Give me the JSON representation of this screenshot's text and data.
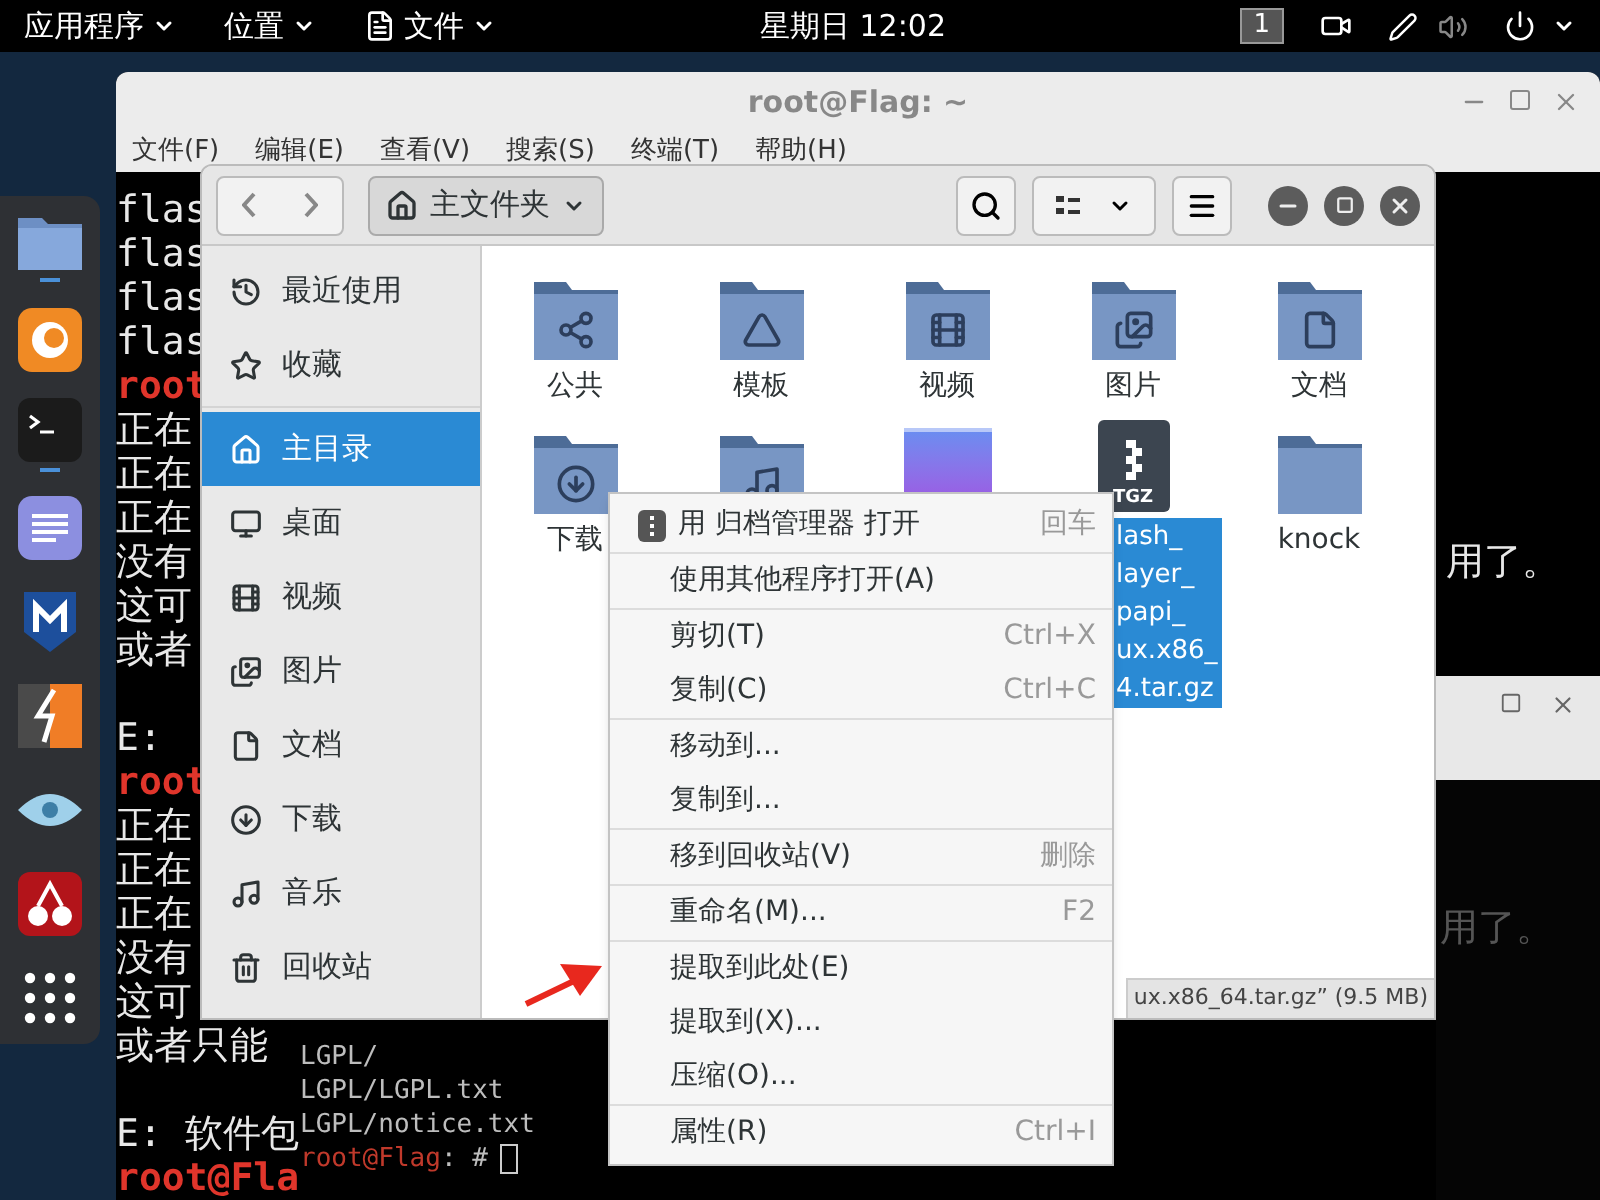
{
  "top_bar": {
    "menus": [
      {
        "label": "应用程序",
        "kind": "text"
      },
      {
        "label": "位置",
        "kind": "text"
      },
      {
        "label": "文件",
        "kind": "app"
      }
    ],
    "clock": "星期日 12:02",
    "workspace": "1"
  },
  "dock": [
    {
      "kind": "files",
      "running": true
    },
    {
      "kind": "browser",
      "running": false
    },
    {
      "kind": "terminal",
      "running": true
    },
    {
      "kind": "editor",
      "running": false
    },
    {
      "kind": "shield",
      "running": false
    },
    {
      "kind": "proxy",
      "running": false
    },
    {
      "kind": "eye",
      "running": false
    },
    {
      "kind": "cherry",
      "running": false
    },
    {
      "kind": "grid",
      "running": false
    }
  ],
  "terminal": {
    "title": "root@Flag: ~",
    "menu": [
      "文件(F)",
      "编辑(E)",
      "查看(V)",
      "搜索(S)",
      "终端(T)",
      "帮助(H)"
    ],
    "lines": [
      {
        "kind": "output",
        "text": "flas"
      },
      {
        "kind": "output",
        "text": "flas"
      },
      {
        "kind": "output",
        "text": "flas"
      },
      {
        "kind": "output",
        "text": "flas"
      },
      {
        "kind": "prompt",
        "text": "root"
      },
      {
        "kind": "output",
        "text": "正在"
      },
      {
        "kind": "output",
        "text": "正在"
      },
      {
        "kind": "output",
        "text": "正在"
      },
      {
        "kind": "output",
        "text": "没有",
        "tail": "用了。"
      },
      {
        "kind": "output",
        "text": "这可"
      },
      {
        "kind": "output",
        "text": "或者"
      },
      {
        "kind": "blank"
      },
      {
        "kind": "output",
        "text": "E:"
      },
      {
        "kind": "prompt",
        "text": "root"
      },
      {
        "kind": "output",
        "text": "正在"
      },
      {
        "kind": "output",
        "text": "正在"
      },
      {
        "kind": "output",
        "text": "正在"
      },
      {
        "kind": "output",
        "text": "没有"
      },
      {
        "kind": "output",
        "text": "这可"
      },
      {
        "kind": "output",
        "text": "或者只能"
      },
      {
        "kind": "blank"
      },
      {
        "kind": "output",
        "text": "E: 软件包"
      },
      {
        "kind": "prompt",
        "text": "root@Fla"
      }
    ],
    "overlay_lines": [
      {
        "kind": "output",
        "text": "LGPL/"
      },
      {
        "kind": "output",
        "text": "LGPL/LGPL.txt"
      },
      {
        "kind": "output",
        "text": "LGPL/notice.txt"
      },
      {
        "kind": "prompt",
        "text": "root@Flag",
        "suffix": ": #",
        "cursor": true
      }
    ]
  },
  "second_terminal": {
    "lines": [
      "用了。"
    ]
  },
  "file_manager": {
    "path": "主文件夹",
    "sidebar": [
      [
        {
          "label": "最近使用",
          "selected": false
        },
        {
          "label": "收藏",
          "selected": false
        }
      ],
      [
        {
          "label": "主目录",
          "selected": true
        },
        {
          "label": "桌面",
          "selected": false
        },
        {
          "label": "视频",
          "selected": false
        },
        {
          "label": "图片",
          "selected": false
        },
        {
          "label": "文档",
          "selected": false
        },
        {
          "label": "下载",
          "selected": false
        },
        {
          "label": "音乐",
          "selected": false
        },
        {
          "label": "回收站",
          "selected": false
        }
      ]
    ],
    "items": [
      {
        "kind": "folder",
        "label": "公共",
        "selected": false
      },
      {
        "kind": "folder",
        "label": "模板",
        "selected": false
      },
      {
        "kind": "folder",
        "label": "视频",
        "selected": false
      },
      {
        "kind": "folder",
        "label": "图片",
        "selected": false
      },
      {
        "kind": "folder",
        "label": "文档",
        "selected": false
      },
      {
        "kind": "folder",
        "label": "下载",
        "selected": false
      },
      {
        "kind": "folder",
        "selected": false
      },
      {
        "kind": "image",
        "selected": false
      },
      {
        "kind": "archive",
        "badge": "TGZ",
        "label_lines": [
          "lash_",
          "layer_",
          "papi_",
          "ux.x86_",
          "4.tar.gz"
        ],
        "selected": true
      },
      {
        "kind": "folder",
        "label": "knock",
        "selected": false
      }
    ],
    "status": "ux.x86_64.tar.gz” (9.5 MB)"
  },
  "context_menu": {
    "groups": [
      [
        {
          "label": "用 归档管理器 打开",
          "shortcut": "回车",
          "icon": true
        }
      ],
      [
        {
          "label": "使用其他程序打开(A)",
          "icon": false
        }
      ],
      [
        {
          "label": "剪切(T)",
          "shortcut": "Ctrl+X",
          "icon": false
        },
        {
          "label": "复制(C)",
          "shortcut": "Ctrl+C",
          "icon": false
        }
      ],
      [
        {
          "label": "移动到...",
          "icon": false
        },
        {
          "label": "复制到...",
          "icon": false
        }
      ],
      [
        {
          "label": "移到回收站(V)",
          "shortcut": "删除",
          "icon": false
        }
      ],
      [
        {
          "label": "重命名(M)...",
          "shortcut": "F2",
          "icon": false
        }
      ],
      [
        {
          "label": "提取到此处(E)",
          "icon": false
        },
        {
          "label": "提取到(X)...",
          "icon": false
        },
        {
          "label": "压缩(O)...",
          "icon": false
        }
      ],
      [
        {
          "label": "属性(R)",
          "shortcut": "Ctrl+I",
          "icon": false
        }
      ]
    ]
  }
}
